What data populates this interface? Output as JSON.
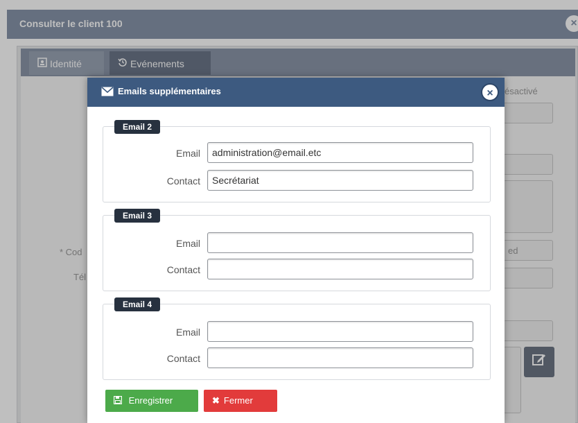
{
  "background": {
    "window_title": "Consulter le client 100",
    "close_icon": "×",
    "tabs": [
      {
        "label": "Identité",
        "icon": "id-card-icon"
      },
      {
        "label": "Evénements",
        "icon": "history-icon"
      }
    ],
    "labels": {
      "desactive": "ésactivé",
      "code": "* Cod",
      "tel": "Tél",
      "field_suffix": "ed"
    }
  },
  "modal": {
    "title": "Emails supplémentaires",
    "sections": [
      {
        "legend": "Email 2",
        "email_label": "Email",
        "email_value": "administration@email.etc",
        "contact_label": "Contact",
        "contact_value": "Secrétariat"
      },
      {
        "legend": "Email 3",
        "email_label": "Email",
        "email_value": "",
        "contact_label": "Contact",
        "contact_value": ""
      },
      {
        "legend": "Email 4",
        "email_label": "Email",
        "email_value": "",
        "contact_label": "Contact",
        "contact_value": ""
      }
    ],
    "buttons": {
      "save_label": "Enregistrer",
      "close_label": "Fermer"
    }
  },
  "colors": {
    "modal_header": "#3d5a80",
    "save_button": "#4caa4a",
    "close_button": "#e23b3b",
    "legend_bg": "#27313f"
  }
}
